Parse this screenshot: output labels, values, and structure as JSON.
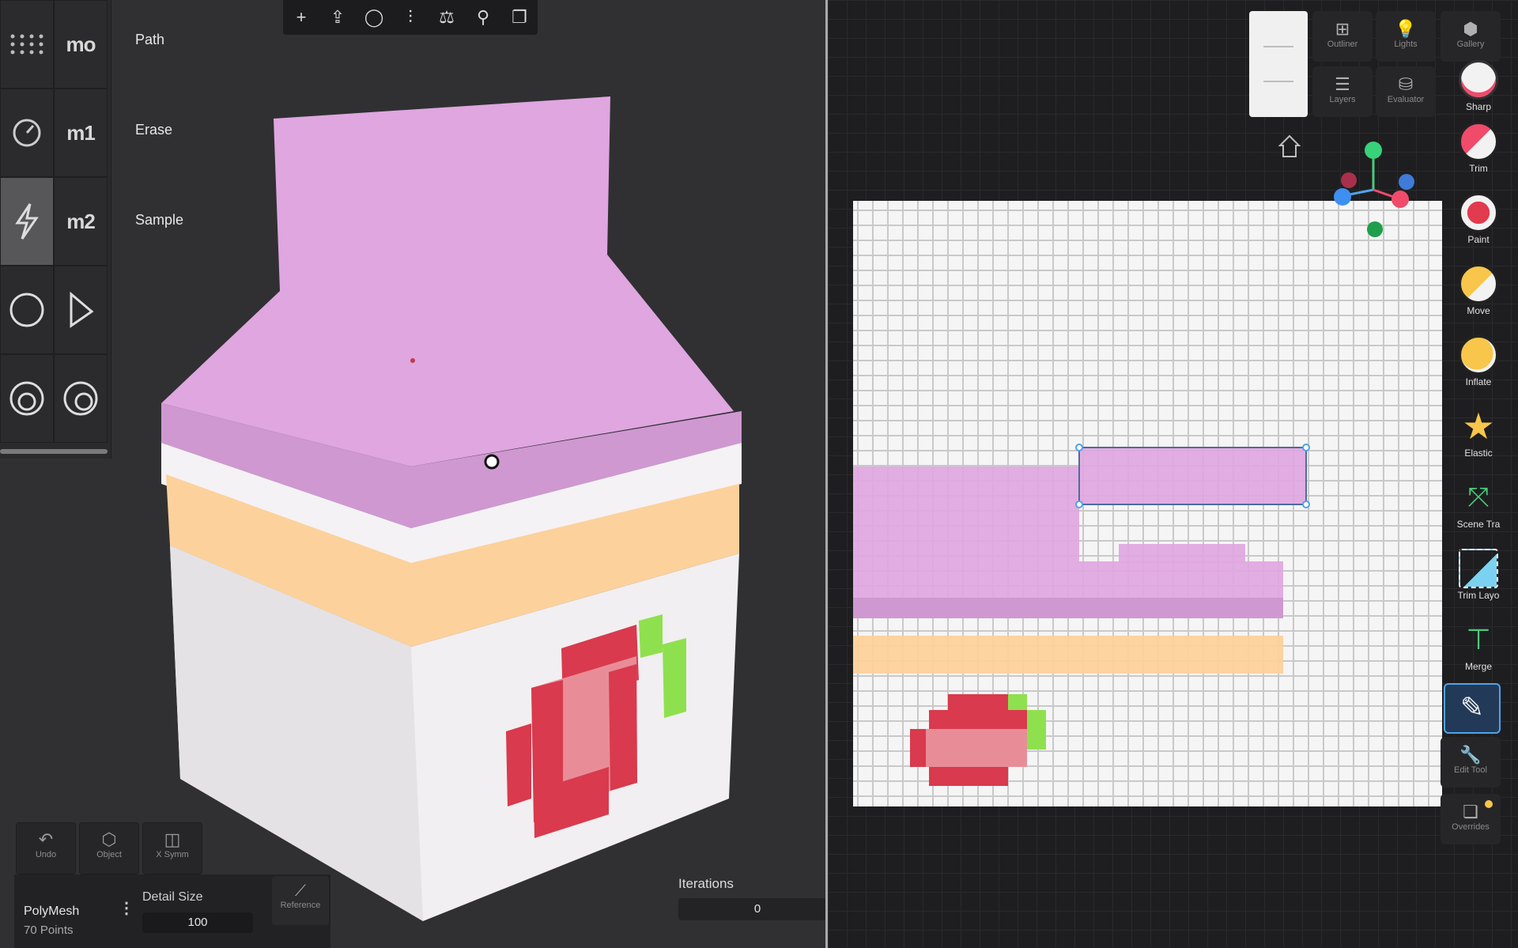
{
  "tool_grid": {
    "labels": {
      "mo": "mo",
      "m1": "m1",
      "m2": "m2"
    },
    "side_labels": {
      "path": "Path",
      "erase": "Erase",
      "sample": "Sample"
    }
  },
  "top_toolbar": {
    "icons": [
      "plus-icon",
      "export-icon",
      "sphere-icon",
      "sliders-icon",
      "symmetry-icon",
      "pin-icon",
      "layers-copy-icon"
    ]
  },
  "bottom_left": {
    "buttons": [
      {
        "label": "Undo"
      },
      {
        "label": "Object"
      },
      {
        "label": "X Symm"
      }
    ],
    "mesh_name": "PolyMesh",
    "mesh_points": "70 Points",
    "detail_size_label": "Detail Size",
    "detail_size_value": "100",
    "reference_label": "Reference"
  },
  "iterations": {
    "label": "Iterations",
    "value": "0"
  },
  "right_panel": {
    "top_buttons": [
      {
        "label": "Outliner"
      },
      {
        "label": "Lights"
      },
      {
        "label": "Gallery"
      },
      {
        "label": "Layers"
      },
      {
        "label": "Evaluator"
      }
    ],
    "tools": [
      {
        "label": "Sharp"
      },
      {
        "label": "Trim"
      },
      {
        "label": "Paint"
      },
      {
        "label": "Move"
      },
      {
        "label": "Inflate"
      },
      {
        "label": "Elastic"
      },
      {
        "label": "Scene Tra"
      },
      {
        "label": "Trim Layo"
      },
      {
        "label": "Merge"
      },
      {
        "label": "Edit Tool"
      },
      {
        "label": "Overrides"
      }
    ]
  },
  "colors": {
    "pink": "#dfa6e0",
    "orange": "#fdd19b",
    "red": "#d93a4d",
    "green": "#8fe04e",
    "accent_blue": "#4fa3e8"
  }
}
